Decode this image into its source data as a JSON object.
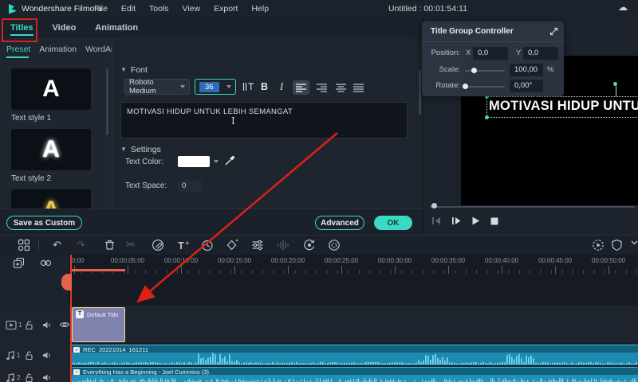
{
  "menubar": {
    "app_name": "Wondershare Filmora",
    "menus": [
      "File",
      "Edit",
      "Tools",
      "View",
      "Export",
      "Help"
    ],
    "project_title": "Untitled : 00:01:54:11"
  },
  "tabs": [
    {
      "label": "Titles",
      "active": true
    },
    {
      "label": "Video",
      "active": false
    },
    {
      "label": "Animation",
      "active": false
    }
  ],
  "left_panel": {
    "subtabs": [
      {
        "label": "Preset",
        "active": true
      },
      {
        "label": "Animation",
        "active": false
      },
      {
        "label": "WordArt",
        "active": false
      }
    ],
    "styles": [
      {
        "label": "Text style 1",
        "letter": "A",
        "variant": "plain"
      },
      {
        "label": "Text style 2",
        "letter": "A",
        "variant": "glow"
      },
      {
        "label": "",
        "letter": "A",
        "variant": "gold"
      }
    ],
    "save_button": "Save as Custom"
  },
  "editor": {
    "font_header": "Font",
    "font_name": "Roboto Medium",
    "font_size": "36",
    "bold_label": "B",
    "italic_label": "I",
    "text_value": "MOTIVASI HIDUP UNTUK LEBIH SEMANGAT",
    "settings_header": "Settings",
    "text_color_label": "Text Color:",
    "text_space_label": "Text Space:",
    "text_space_value": "0",
    "advanced_button": "Advanced",
    "ok_button": "OK"
  },
  "controller": {
    "title": "Title Group Controller",
    "position_label": "Position:",
    "x_label": "X",
    "x_value": "0,0",
    "y_label": "Y",
    "y_value": "0,0",
    "scale_label": "Scale:",
    "scale_value": "100,00",
    "scale_unit": "%",
    "rotate_label": "Rotate:",
    "rotate_value": "0,00°"
  },
  "preview": {
    "overlay_text": "MOTIVASI HIDUP UNTUK LEBIH SEMANGAT"
  },
  "timeline": {
    "ruler_first": "0:00",
    "ruler_labels": [
      "00:00:05:00",
      "00:00:10:00",
      "00:00:15:00",
      "00:00:20:00",
      "00:00:25:00",
      "00:00:30:00",
      "00:00:35:00",
      "00:00:40:00",
      "00:00:45:00",
      "00:00:50:00"
    ],
    "tracks": [
      {
        "type": "video",
        "index": "1",
        "clip_name": "Default Title"
      },
      {
        "type": "audio",
        "index": "1",
        "clip_name": "REC_20221014_161211"
      },
      {
        "type": "audio",
        "index": "2",
        "clip_name": "Everything Has a Beginning - Joel Cummins (3)"
      }
    ]
  },
  "colors": {
    "accent": "#3bd9c4",
    "annotation_red": "#cf241b",
    "playhead": "#e23a24",
    "title_clip": "#7f83ae",
    "title_clip_border": "#ecd98f",
    "audio_clip": "#1f89ae"
  }
}
